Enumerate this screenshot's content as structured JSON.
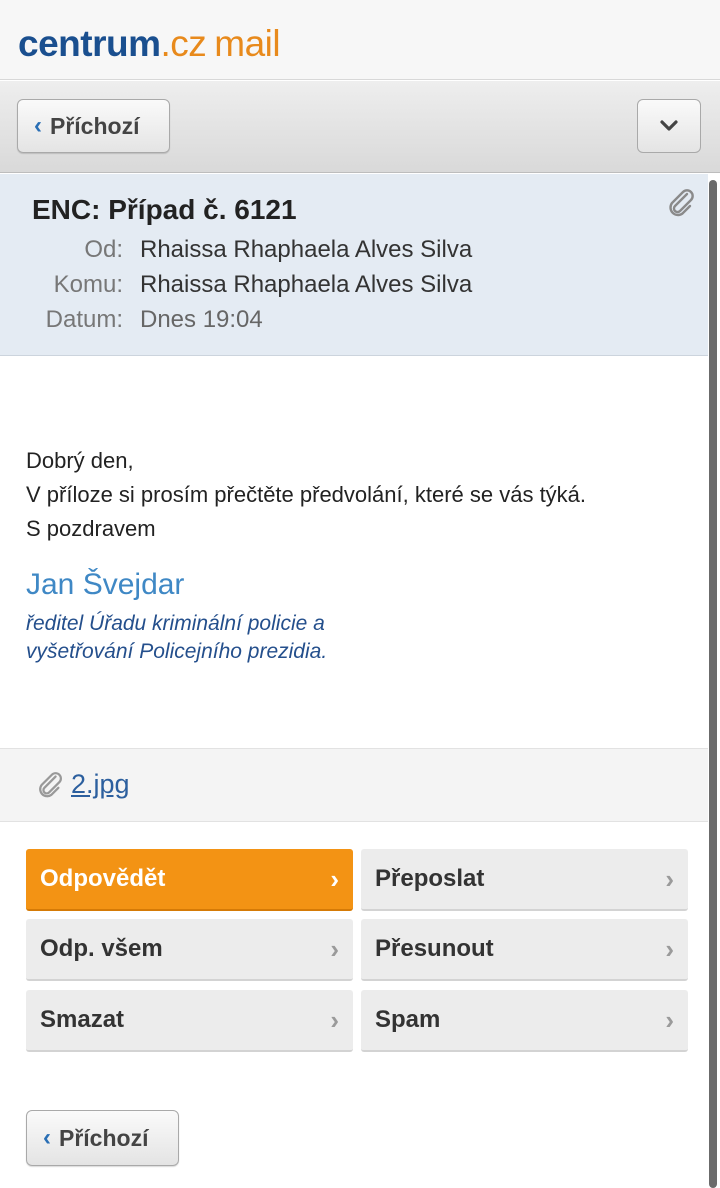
{
  "brand": {
    "part1": "cen",
    "part2": "trum",
    "part3": ".cz",
    "part4": "mail"
  },
  "toolbar": {
    "back_label": "Příchozí",
    "menu_icon": "chevron-down-icon"
  },
  "message": {
    "subject": "ENC: Případ č. 6121",
    "from_label": "Od:",
    "from_value": "Rhaissa Rhaphaela Alves Silva",
    "to_label": "Komu:",
    "to_value": "Rhaissa Rhaphaela Alves Silva",
    "date_label": "Datum:",
    "date_value": "Dnes 19:04",
    "body_lines": [
      "Dobrý den,",
      "V příloze si prosím přečtěte předvolání, které se vás týká.",
      "S pozdravem"
    ],
    "signature_name": "Jan Švejdar",
    "signature_title_1": "ředitel Úřadu kriminální policie a",
    "signature_title_2": "vyšetřování Policejního prezidia."
  },
  "attachment": {
    "filename": "2.jpg"
  },
  "actions": {
    "reply": "Odpovědět",
    "forward": "Přeposlat",
    "reply_all": "Odp. všem",
    "move": "Přesunout",
    "delete": "Smazat",
    "spam": "Spam"
  },
  "footer": {
    "back_label": "Příchozí"
  },
  "colors": {
    "accent_orange": "#f39314",
    "brand_blue": "#1a4f8f",
    "link_blue": "#3f88c5"
  }
}
